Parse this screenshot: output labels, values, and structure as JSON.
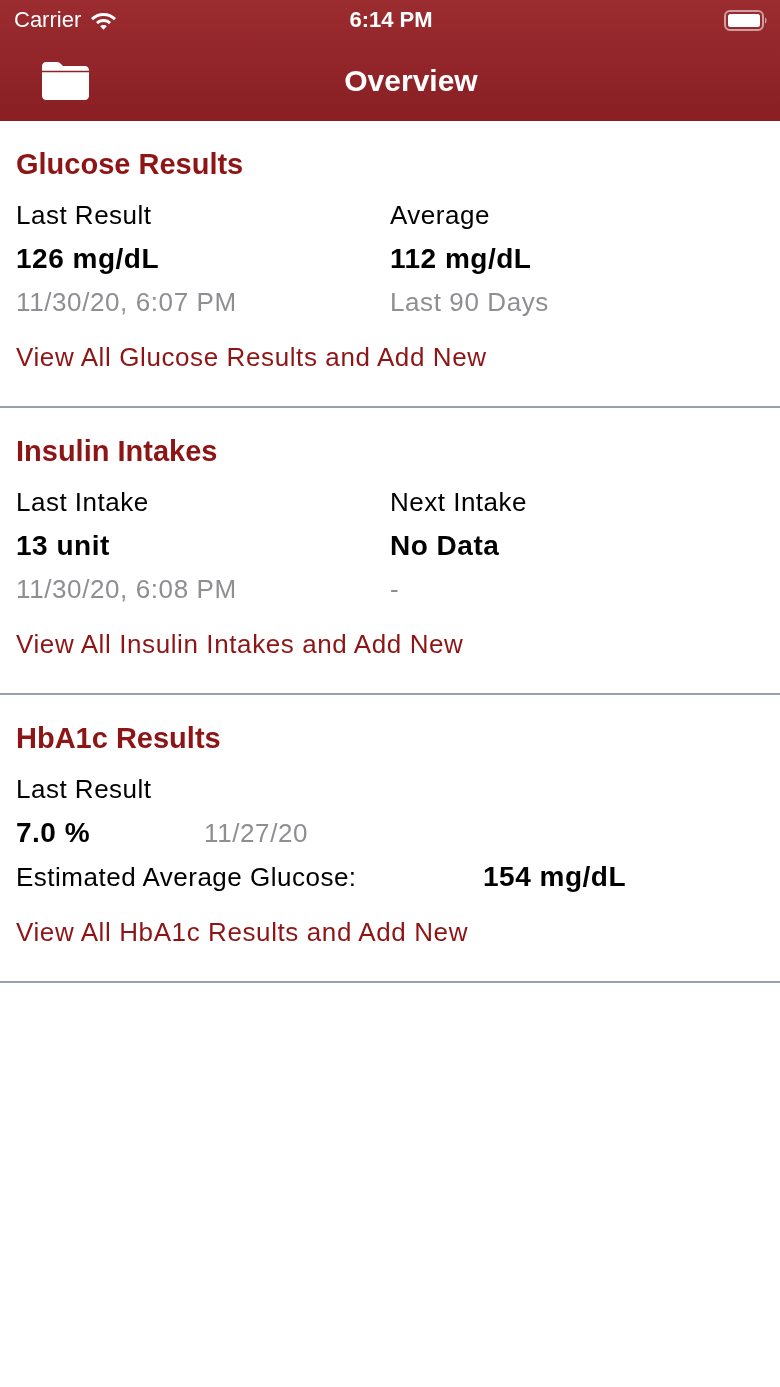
{
  "status_bar": {
    "carrier": "Carrier",
    "time": "6:14 PM"
  },
  "nav_bar": {
    "title": "Overview"
  },
  "sections": [
    {
      "kind": "two_column",
      "title": "Glucose Results",
      "columns": [
        {
          "label": "Last Result",
          "value": "126 mg/dL",
          "detail": "11/30/20, 6:07 PM"
        },
        {
          "label": "Average",
          "value": "112 mg/dL",
          "detail": "Last 90 Days"
        }
      ],
      "link": "View All Glucose Results and Add New"
    },
    {
      "kind": "two_column",
      "title": "Insulin Intakes",
      "columns": [
        {
          "label": "Last Intake",
          "value": "13 unit",
          "detail": "11/30/20, 6:08 PM"
        },
        {
          "label": "Next Intake",
          "value": "No Data",
          "detail": "-"
        }
      ],
      "link": "View All Insulin Intakes and Add New"
    },
    {
      "kind": "hba1c",
      "title": "HbA1c Results",
      "label": "Last Result",
      "value": "7.0 %",
      "date": "11/27/20",
      "estimate_label": "Estimated Average Glucose:",
      "estimate_value": "154 mg/dL",
      "link": "View All HbA1c Results and Add New"
    }
  ]
}
